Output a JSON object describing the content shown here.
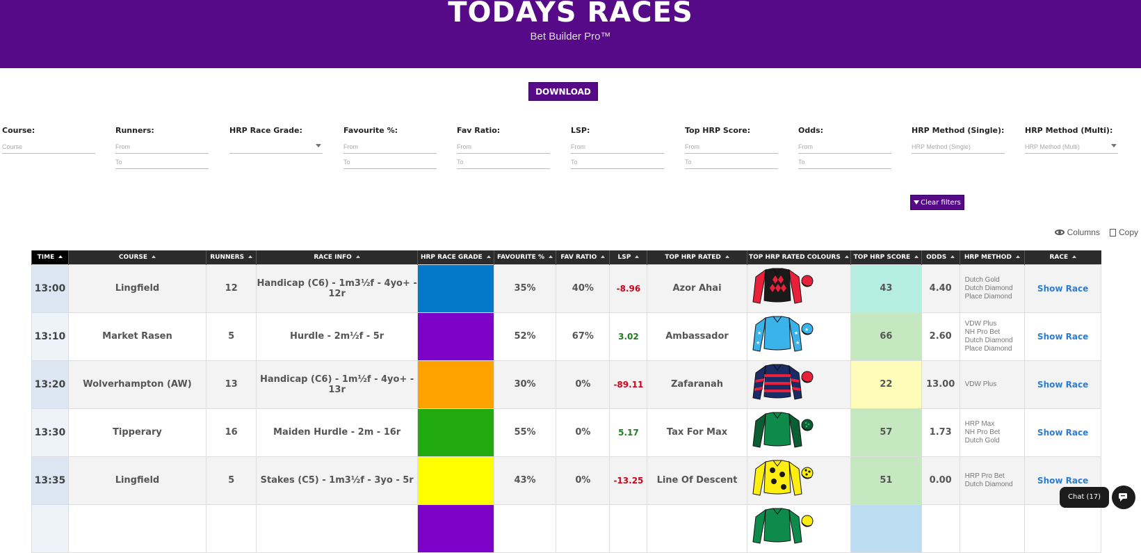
{
  "header": {
    "title": "TODAYS RACES",
    "subtitle": "Bet Builder Pro™"
  },
  "download_label": "DOWNLOAD",
  "filters": [
    {
      "label": "Course:",
      "inputs": [
        "Course"
      ],
      "dropdown": false
    },
    {
      "label": "Runners:",
      "inputs": [
        "From",
        "To"
      ],
      "dropdown": false
    },
    {
      "label": "HRP Race Grade:",
      "inputs": [
        ""
      ],
      "dropdown": true
    },
    {
      "label": "Favourite %:",
      "inputs": [
        "From",
        "To"
      ],
      "dropdown": false
    },
    {
      "label": "Fav Ratio:",
      "inputs": [
        "From",
        "To"
      ],
      "dropdown": false
    },
    {
      "label": "LSP:",
      "inputs": [
        "From",
        "To"
      ],
      "dropdown": false
    },
    {
      "label": "Top HRP Score:",
      "inputs": [
        "From",
        "To"
      ],
      "dropdown": false
    },
    {
      "label": "Odds:",
      "inputs": [
        "From",
        "To"
      ],
      "dropdown": false
    },
    {
      "label": "HRP Method (Single):",
      "inputs": [
        "HRP Method (Single)"
      ],
      "dropdown": false
    },
    {
      "label": "HRP Method (Multi):",
      "inputs": [
        "HRP Method (Multi)"
      ],
      "dropdown": true
    }
  ],
  "clear_filters_label": "Clear filters",
  "tools": {
    "columns": "Columns",
    "copy": "Copy"
  },
  "columns": [
    "TIME",
    "COURSE",
    "RUNNERS",
    "RACE INFO",
    "HRP RACE GRADE",
    "FAVOURITE %",
    "FAV RATIO",
    "LSP",
    "TOP HRP RATED",
    "TOP HRP RATED COLOURS",
    "TOP HRP SCORE",
    "ODDS",
    "HRP METHOD",
    "RACE"
  ],
  "rows": [
    {
      "time": "13:00",
      "course": "Lingfield",
      "runners": "12",
      "race_info": "Handicap (C6) - 1m3½f - 4yo+ - 12r",
      "grade_color": "#0479c9",
      "fav_pct": "35%",
      "fav_ratio": "40%",
      "lsp": "-8.96",
      "lsp_sign": "neg",
      "top_rated": "Azor Ahai",
      "silk": "diamonds",
      "score": "43",
      "score_color": "#b6ede3",
      "odds": "4.40",
      "methods": [
        "Dutch Gold",
        "Dutch Diamond",
        "Place Diamond"
      ],
      "race_link": "Show Race"
    },
    {
      "time": "13:10",
      "course": "Market Rasen",
      "runners": "5",
      "race_info": "Hurdle - 2m½f - 5r",
      "grade_color": "#7d03c9",
      "fav_pct": "52%",
      "fav_ratio": "67%",
      "lsp": "3.02",
      "lsp_sign": "pos",
      "top_rated": "Ambassador",
      "silk": "stars",
      "score": "66",
      "score_color": "#c6e8c0",
      "odds": "2.60",
      "methods": [
        "VDW Plus",
        "NH Pro Bet",
        "Dutch Diamond",
        "Place Diamond"
      ],
      "race_link": "Show Race"
    },
    {
      "time": "13:20",
      "course": "Wolverhampton (AW)",
      "runners": "13",
      "race_info": "Handicap (C6) - 1m½f - 4yo+ - 13r",
      "grade_color": "#ffa200",
      "fav_pct": "30%",
      "fav_ratio": "0%",
      "lsp": "-89.11",
      "lsp_sign": "neg",
      "top_rated": "Zafaranah",
      "silk": "hoops",
      "score": "22",
      "score_color": "#fdfcb9",
      "odds": "13.00",
      "methods": [
        "VDW Plus"
      ],
      "race_link": "Show Race"
    },
    {
      "time": "13:30",
      "course": "Tipperary",
      "runners": "16",
      "race_info": "Maiden Hurdle - 2m - 16r",
      "grade_color": "#21aa10",
      "fav_pct": "55%",
      "fav_ratio": "0%",
      "lsp": "5.17",
      "lsp_sign": "pos",
      "top_rated": "Tax For Max",
      "silk": "green",
      "score": "57",
      "score_color": "#c6e8c0",
      "odds": "1.73",
      "methods": [
        "HRP Max",
        "NH Pro Bet",
        "Dutch Gold"
      ],
      "race_link": "Show Race"
    },
    {
      "time": "13:35",
      "course": "Lingfield",
      "runners": "5",
      "race_info": "Stakes (C5) - 1m3½f - 3yo - 5r",
      "grade_color": "#ffff00",
      "fav_pct": "43%",
      "fav_ratio": "0%",
      "lsp": "-13.25",
      "lsp_sign": "neg",
      "top_rated": "Line Of Descent",
      "silk": "spots",
      "score": "51",
      "score_color": "#c6e8c0",
      "odds": "0.00",
      "methods": [
        "HRP Pro Bet",
        "Dutch Diamond"
      ],
      "race_link": "Show Race"
    },
    {
      "time": "",
      "course": "",
      "runners": "",
      "race_info": "",
      "grade_color": "#7d03c9",
      "fav_pct": "",
      "fav_ratio": "",
      "lsp": "",
      "lsp_sign": "pos",
      "top_rated": "",
      "silk": "partial",
      "score": "",
      "score_color": "#bcdcf2",
      "odds": "",
      "methods": [],
      "race_link": ""
    }
  ],
  "chat": {
    "label": "Chat (17)"
  }
}
